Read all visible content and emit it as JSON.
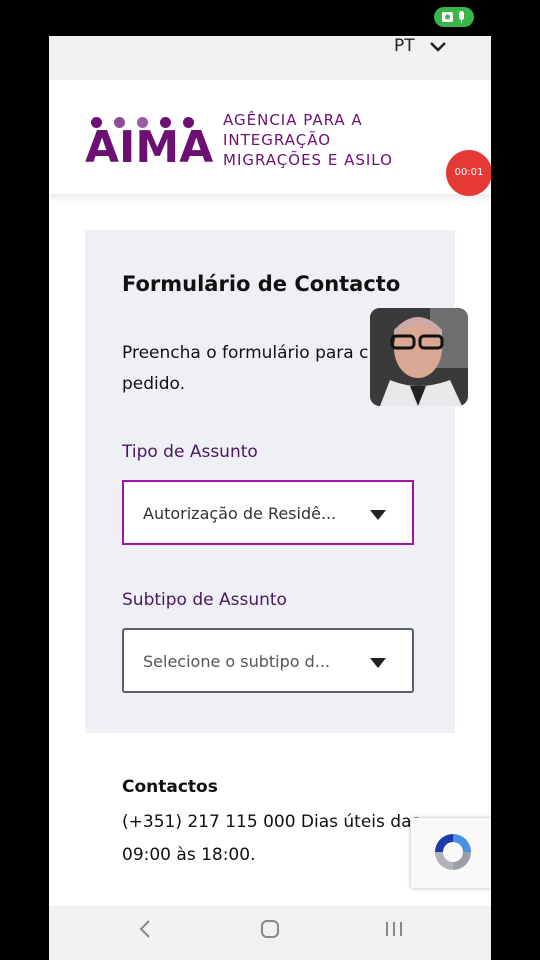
{
  "status": {
    "indicator_color": "#3bb54a"
  },
  "topbar": {
    "language": "PT"
  },
  "header": {
    "logo_word": "AIMA",
    "logo_lines": [
      "AGÊNCIA PARA A",
      "INTEGRAÇÃO",
      "MIGRAÇÕES E ASILO"
    ],
    "brand_color": "#6d0f73",
    "recording_time": "00:01"
  },
  "form": {
    "title": "Formulário de Contacto",
    "description": "Preencha o formulário para c um pedido.",
    "tipo_label": "Tipo de Assunto",
    "tipo_value": "Autorização de Residê...",
    "subtipo_label": "Subtipo de Assunto",
    "subtipo_placeholder": "Selecione o subtipo d..."
  },
  "contacts": {
    "heading": "Contactos",
    "text": "(+351) 217 115 000 Dias úteis das 09:00 às 18:00."
  },
  "nav": {
    "back": "<",
    "home": "○",
    "recents": "|||"
  }
}
